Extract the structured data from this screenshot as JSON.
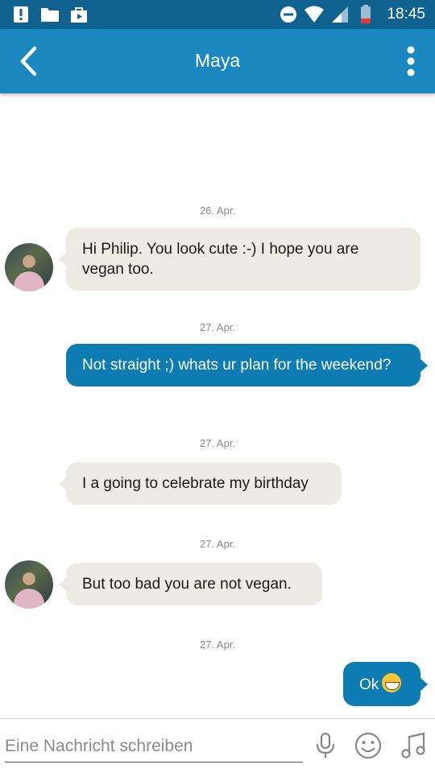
{
  "status_bar": {
    "time": "18:45"
  },
  "header": {
    "title": "Maya"
  },
  "messages": [
    {
      "date": "26. Apr.",
      "direction": "in",
      "text": "Hi Philip. You look cute :-) I hope you are vegan too."
    },
    {
      "date": "27. Apr.",
      "direction": "out",
      "text": "Not straight ;) whats ur plan for the weekend?"
    },
    {
      "date": "27. Apr.",
      "direction": "in",
      "text": "I a going to celebrate my birthday"
    },
    {
      "date": "27. Apr.",
      "direction": "in",
      "text": "But too bad you are not vegan."
    },
    {
      "date": "27. Apr.",
      "direction": "out",
      "text": "Ok",
      "emoji": "grinning-face-emoji"
    }
  ],
  "composer": {
    "placeholder": "Eine Nachricht schreiben",
    "icons": [
      "microphone-icon",
      "smiley-icon",
      "music-note-icon"
    ]
  },
  "colors": {
    "status_bar": "#0f6290",
    "app_bar": "#1a87be",
    "outgoing_bubble": "#0d7cb3",
    "incoming_bubble": "#eeebe4",
    "date_text": "#8a8a8a"
  }
}
